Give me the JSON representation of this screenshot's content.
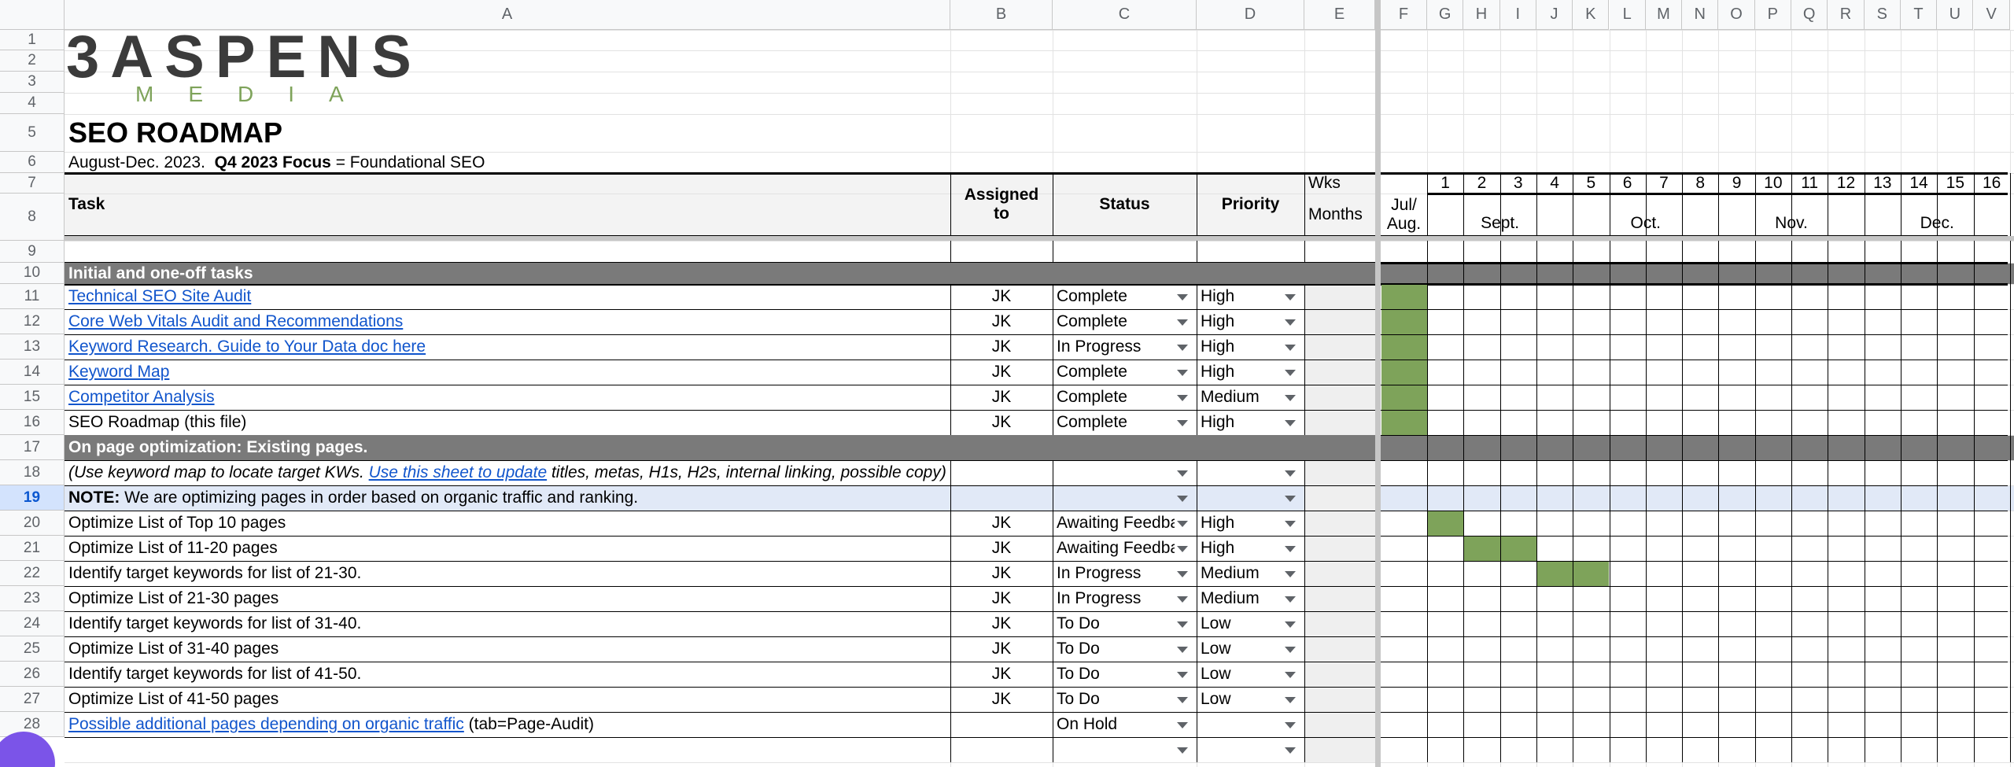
{
  "columns": [
    "A",
    "B",
    "C",
    "D",
    "E",
    "F",
    "G",
    "H",
    "I",
    "J",
    "K",
    "L",
    "M",
    "N",
    "O",
    "P",
    "Q",
    "R",
    "S",
    "T",
    "U",
    "V"
  ],
  "row_numbers": [
    "1",
    "2",
    "3",
    "4",
    "5",
    "6",
    "7",
    "8",
    "9",
    "10",
    "11",
    "12",
    "13",
    "14",
    "15",
    "16",
    "17",
    "18",
    "19",
    "20",
    "21",
    "22",
    "23",
    "24",
    "25",
    "26",
    "27",
    "28"
  ],
  "selected_row": "19",
  "logo": {
    "top": "3ASPENS",
    "bottom": "MEDIA"
  },
  "title": "SEO ROADMAP",
  "subtitle": {
    "prefix": "August-Dec. 2023.  ",
    "focus_label": "Q4 2023 Focus",
    "suffix": " = Foundational SEO"
  },
  "header": {
    "task": "Task",
    "assigned": "Assigned to",
    "status": "Status",
    "priority": "Priority",
    "wks": "Wks",
    "months": "Months",
    "julaug": "Jul/ Aug.",
    "week_numbers": [
      "1",
      "2",
      "3",
      "4",
      "5",
      "6",
      "7",
      "8",
      "9",
      "10",
      "11",
      "12",
      "13",
      "14",
      "15",
      "16"
    ],
    "month_labels": [
      "Sept.",
      "Oct.",
      "Nov.",
      "Dec."
    ]
  },
  "sections": {
    "initial": "Initial and one-off tasks",
    "onpage": "On page optimization: Existing pages."
  },
  "rows": [
    {
      "task": "Technical SEO Site Audit",
      "link": true,
      "assigned": "JK",
      "status": "Complete",
      "priority": "High"
    },
    {
      "task": "Core Web Vitals Audit and Recommendations",
      "link": true,
      "assigned": "JK",
      "status": "Complete",
      "priority": "High"
    },
    {
      "task": "Keyword Research. Guide to Your Data doc here",
      "link": true,
      "assigned": "JK",
      "status": "In Progress",
      "priority": "High"
    },
    {
      "task": "Keyword Map ",
      "link": true,
      "assigned": "JK",
      "status": "Complete",
      "priority": "High"
    },
    {
      "task": "Competitor Analysis",
      "link": true,
      "assigned": "JK",
      "status": "Complete",
      "priority": "Medium"
    },
    {
      "task": "SEO Roadmap (this file)",
      "link": false,
      "assigned": "JK",
      "status": "Complete",
      "priority": "High"
    }
  ],
  "row18": {
    "pre": "(Use keyword map to locate target KWs. ",
    "link": "Use this sheet to update",
    "post": " titles, metas, H1s, H2s, internal linking, possible copy)"
  },
  "row19": {
    "label": "NOTE:",
    "text": " We are optimizing pages in order based on organic traffic and ranking."
  },
  "rows2": [
    {
      "task": "Optimize List of Top 10 pages",
      "assigned": "JK",
      "status": "Awaiting Feedback",
      "priority": "High"
    },
    {
      "task": "Optimize List of 11-20 pages",
      "assigned": "JK",
      "status": "Awaiting Feedback",
      "priority": "High"
    },
    {
      "task": "Identify target keywords for list of 21-30.",
      "assigned": "JK",
      "status": "In Progress",
      "priority": "Medium"
    },
    {
      "task": "Optimize List of 21-30 pages",
      "assigned": "JK",
      "status": "In Progress",
      "priority": "Medium"
    },
    {
      "task": "Identify target keywords for list of 31-40.",
      "assigned": "JK",
      "status": "To Do",
      "priority": "Low"
    },
    {
      "task": "Optimize List of 31-40 pages",
      "assigned": "JK",
      "status": "To Do",
      "priority": "Low"
    },
    {
      "task": "Identify target keywords for list of 41-50.",
      "assigned": "JK",
      "status": "To Do",
      "priority": "Low"
    },
    {
      "task": "Optimize List of 41-50 pages",
      "assigned": "JK",
      "status": "To Do",
      "priority": "Low"
    }
  ],
  "row28": {
    "link": "Possible additional pages depending on organic traffic",
    "post": " (tab=Page-Audit)",
    "status": "On Hold"
  },
  "gantt": [
    {
      "row": "11",
      "weeks": [
        "Jul/Aug"
      ]
    },
    {
      "row": "12",
      "weeks": [
        "Jul/Aug"
      ]
    },
    {
      "row": "13",
      "weeks": [
        "Jul/Aug"
      ]
    },
    {
      "row": "14",
      "weeks": [
        "Jul/Aug"
      ]
    },
    {
      "row": "15",
      "weeks": [
        "Jul/Aug"
      ]
    },
    {
      "row": "16",
      "weeks": [
        "Jul/Aug"
      ]
    },
    {
      "row": "20",
      "weeks": [
        "1"
      ]
    },
    {
      "row": "21",
      "weeks": [
        "2",
        "3"
      ]
    },
    {
      "row": "22",
      "weeks": [
        "4",
        "5"
      ]
    }
  ],
  "colors": {
    "gantt_fill": "#7ea35a",
    "section_bg": "#7a7a7a",
    "link": "#1155cc",
    "selected_row": "#e1e9f7"
  }
}
